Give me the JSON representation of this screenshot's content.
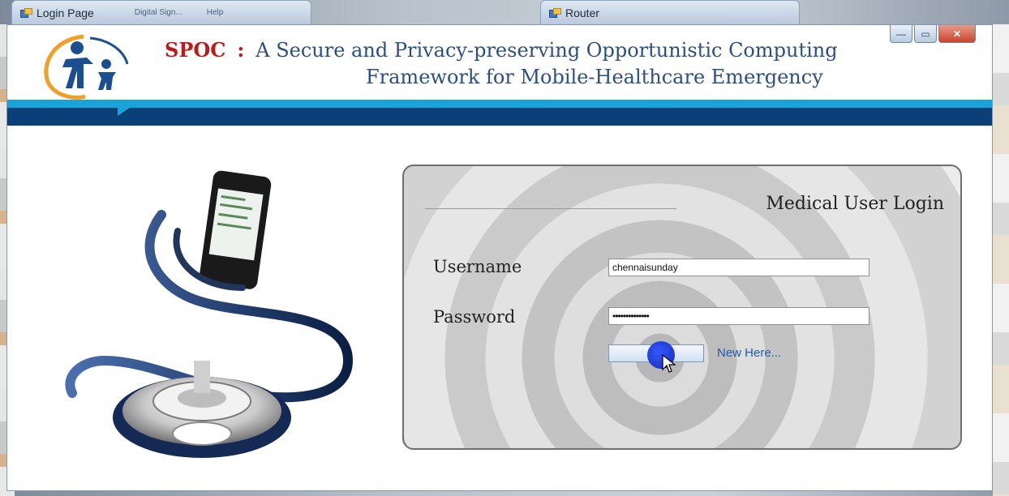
{
  "background_tabs": {
    "login_tab": "Login Page",
    "faded_1": "Digital Sign...",
    "faded_2": "Help",
    "router_tab": "Router"
  },
  "window": {
    "controls": {
      "minimize": "—",
      "maximize": "▭",
      "close": "✕"
    }
  },
  "header": {
    "brand": "SPOC",
    "colon": ":",
    "title_line1": "A Secure and Privacy-preserving Opportunistic Computing",
    "title_line2": "Framework for Mobile-Healthcare Emergency"
  },
  "login_panel": {
    "title": "Medical User Login",
    "username_label": "Username",
    "username_value": "chennaisunday",
    "password_label": "Password",
    "password_value": "••••••••••••••",
    "login_button": "Lo",
    "new_here_link": "New Here..."
  },
  "colors": {
    "brand_red": "#b81c1c",
    "title_blue": "#2d4f7c",
    "band_light": "#19a3d8",
    "band_dark": "#0a3f78",
    "link_blue": "#1e5aa8"
  },
  "icons": [
    "app-window-icon",
    "family-logo-icon",
    "stethoscope-phone-illustration",
    "mouse-pointer-icon"
  ]
}
